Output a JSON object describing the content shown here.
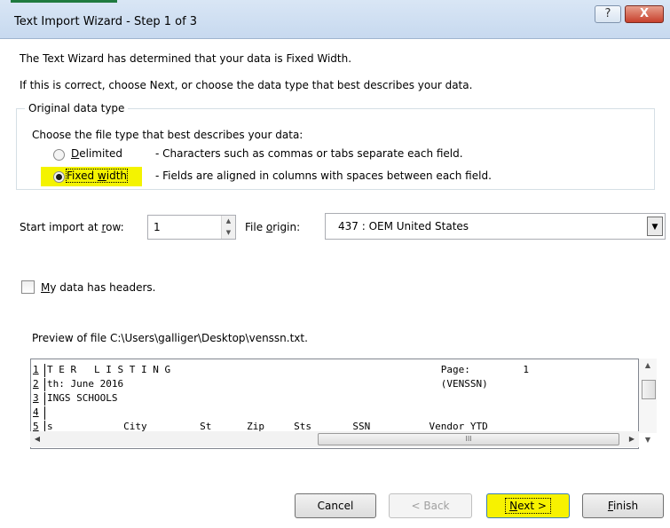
{
  "window": {
    "title": "Text Import Wizard - Step 1 of 3",
    "help_label": "?",
    "close_label": "X"
  },
  "intro": {
    "line1": "The Text Wizard has determined that your data is Fixed Width.",
    "line2": "If this is correct, choose Next, or choose the data type that best describes your data."
  },
  "original_data_type": {
    "group_label": "Original data type",
    "prompt": "Choose the file type that best describes your data:",
    "options": [
      {
        "pre": "",
        "u": "D",
        "post": "elimited",
        "description": "- Characters such as commas or tabs separate each field.",
        "selected": false
      },
      {
        "pre": "Fixed ",
        "u": "w",
        "post": "idth",
        "description": "- Fields are aligned in columns with spaces between each field.",
        "selected": true
      }
    ]
  },
  "import_settings": {
    "start_row_label_pre": "Start import at ",
    "start_row_label_u": "r",
    "start_row_label_post": "ow:",
    "start_row_value": "1",
    "file_origin_label_pre": "File ",
    "file_origin_label_u": "o",
    "file_origin_label_post": "rigin:",
    "file_origin_value": "437 : OEM United States"
  },
  "headers_checkbox": {
    "label_u": "M",
    "label_post": "y data has headers.",
    "checked": false
  },
  "preview": {
    "label": "Preview of file C:\\Users\\galliger\\Desktop\\venssn.txt.",
    "rows": [
      {
        "num": "1",
        "text": "T E R   L I S T I N G                                              Page:         1"
      },
      {
        "num": "2",
        "text": "th: June 2016                                                      (VENSSN)"
      },
      {
        "num": "3",
        "text": "INGS SCHOOLS"
      },
      {
        "num": "4",
        "text": ""
      },
      {
        "num": "5",
        "text": "s            City         St      Zip     Sts       SSN          Vendor YTD"
      }
    ],
    "scroll_thumb_label": "III"
  },
  "buttons": {
    "cancel": "Cancel",
    "back": "< Back",
    "next_u": "N",
    "next_post": "ext >",
    "finish_u": "F",
    "finish_post": "inish"
  },
  "colors": {
    "highlight": "#f4f300",
    "titlebar": "#c7d9ef"
  }
}
